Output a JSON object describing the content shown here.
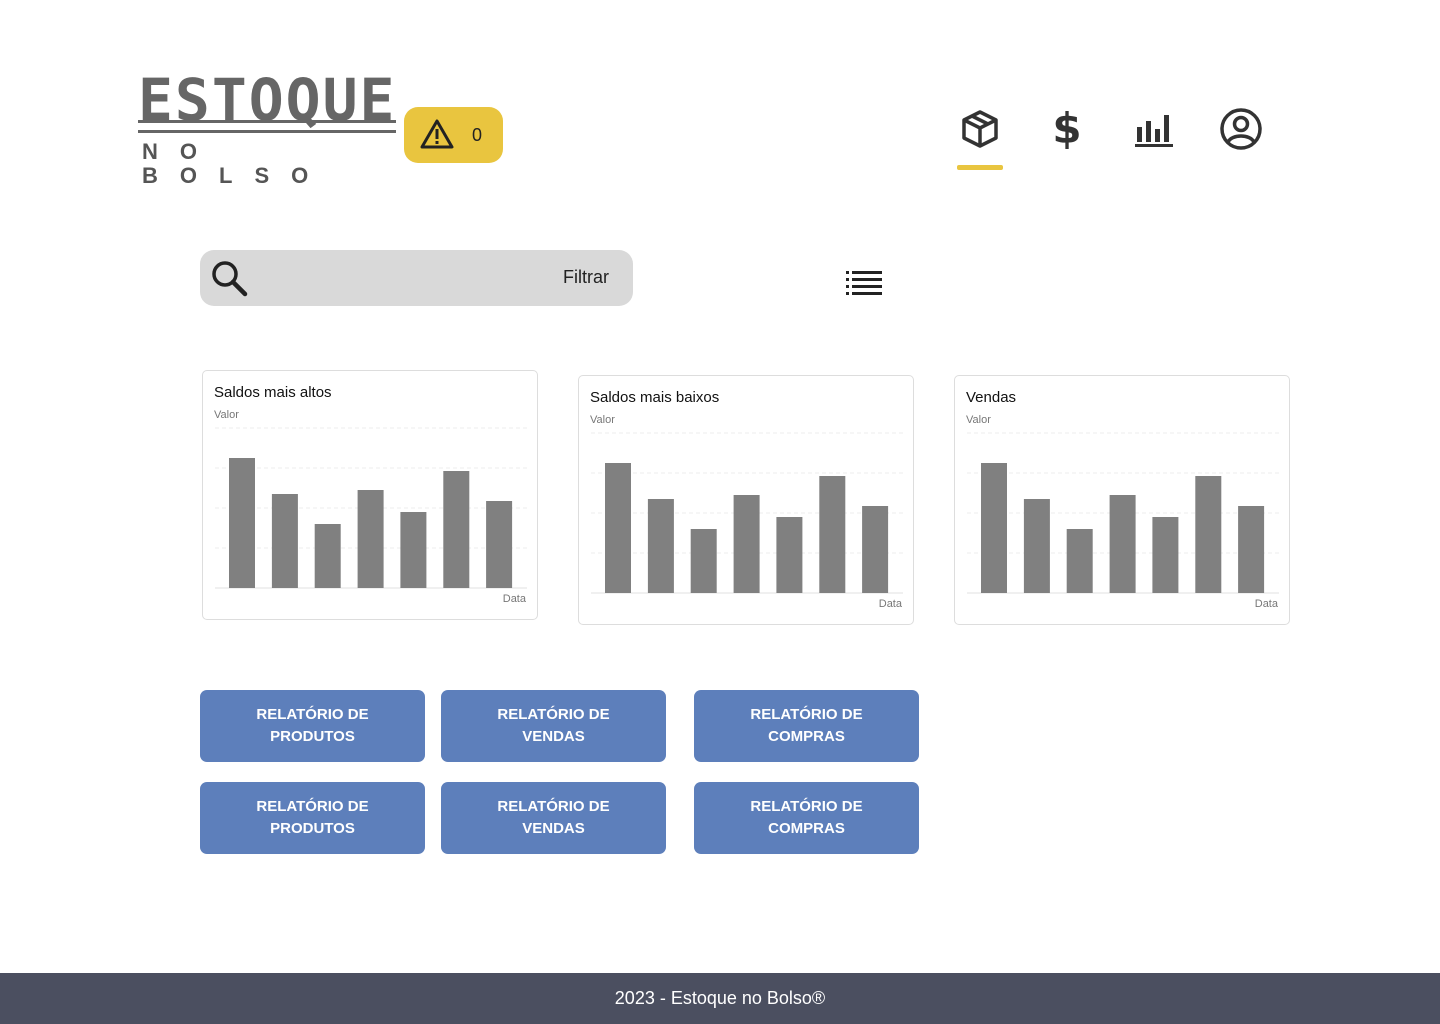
{
  "logo": {
    "top_text": "ESTOQUE",
    "bottom_text": "NO BOLSO",
    "brand_color": "#666666"
  },
  "alert": {
    "icon": "warning-icon",
    "count": "0",
    "color": "#e9c53f"
  },
  "nav": {
    "items": [
      {
        "icon": "box-icon",
        "active": true
      },
      {
        "icon": "dollar-icon",
        "label": "$",
        "active": false
      },
      {
        "icon": "bar-chart-icon",
        "active": false
      },
      {
        "icon": "user-circle-icon",
        "active": false
      }
    ],
    "active_color": "#e9c53f"
  },
  "search": {
    "icon": "search-icon",
    "filter_label": "Filtrar"
  },
  "list_toggle": {
    "icon": "list-icon"
  },
  "charts": [
    {
      "title": "Saldos mais altos",
      "ylabel": "Valor",
      "xlabel": "Data"
    },
    {
      "title": "Saldos mais baixos",
      "ylabel": "Valor",
      "xlabel": "Data"
    },
    {
      "title": "Vendas",
      "ylabel": "Valor",
      "xlabel": "Data"
    }
  ],
  "chart_data": [
    {
      "type": "bar",
      "title": "Saldos mais altos",
      "xlabel": "Data",
      "ylabel": "Valor",
      "values": [
        130,
        94,
        64,
        98,
        76,
        117,
        87
      ],
      "ylim": [
        0,
        160
      ],
      "grid": true,
      "bar_color": "#808080"
    },
    {
      "type": "bar",
      "title": "Saldos mais baixos",
      "xlabel": "Data",
      "ylabel": "Valor",
      "values": [
        130,
        94,
        64,
        98,
        76,
        117,
        87
      ],
      "ylim": [
        0,
        160
      ],
      "grid": true,
      "bar_color": "#808080"
    },
    {
      "type": "bar",
      "title": "Vendas",
      "xlabel": "Data",
      "ylabel": "Valor",
      "values": [
        130,
        94,
        64,
        98,
        76,
        117,
        87
      ],
      "ylim": [
        0,
        160
      ],
      "grid": true,
      "bar_color": "#808080"
    }
  ],
  "reports": [
    {
      "label": "RELATÓRIO DE PRODUTOS"
    },
    {
      "label": "RELATÓRIO DE VENDAS"
    },
    {
      "label": "RELATÓRIO DE COMPRAS"
    },
    {
      "label": "RELATÓRIO DE PRODUTOS"
    },
    {
      "label": "RELATÓRIO DE VENDAS"
    },
    {
      "label": "RELATÓRIO DE COMPRAS"
    }
  ],
  "report_color": "#5d7fbb",
  "footer": {
    "text": "2023 - Estoque no Bolso®",
    "color": "#4b4f60"
  }
}
